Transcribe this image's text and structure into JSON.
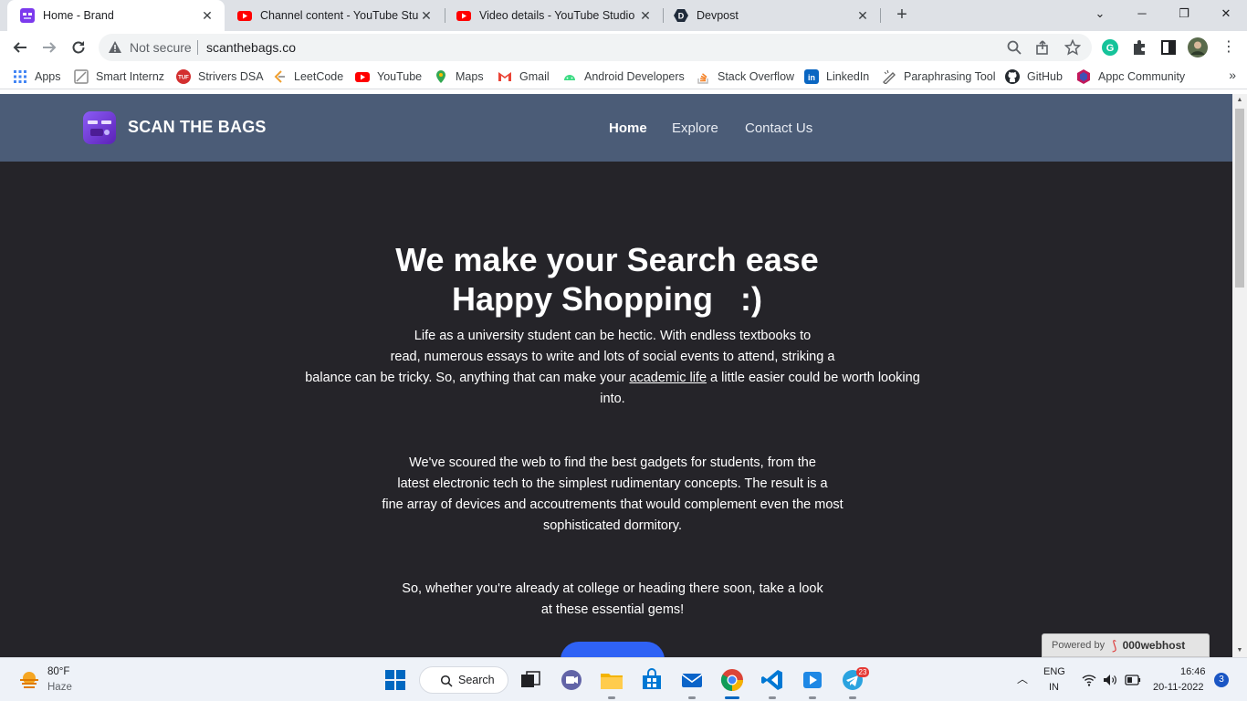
{
  "browser": {
    "tabs": [
      {
        "label": "Home - Brand",
        "favicon": "brand-favicon",
        "active": true
      },
      {
        "label": "Channel content - YouTube Studio",
        "favicon": "youtube-favicon",
        "active": false
      },
      {
        "label": "Video details - YouTube Studio",
        "favicon": "youtube-favicon",
        "active": false
      },
      {
        "label": "Devpost",
        "favicon": "devpost-favicon",
        "active": false
      }
    ],
    "tab_close": "✕",
    "new_tab": "+",
    "window_controls": {
      "minimize": "─",
      "restore": "❐",
      "close": "✕",
      "tab_search": "⌄"
    },
    "security_label": "Not secure",
    "url": "scanthebags.co",
    "bookmarks": [
      {
        "label": "Apps",
        "icon": "apps-grid-icon",
        "color": "#5f6368"
      },
      {
        "label": "Smart Internz",
        "icon": "smart-internz-icon",
        "color": "#888888"
      },
      {
        "label": "Strivers DSA",
        "icon": "strivers-icon",
        "color": "#d32f2f"
      },
      {
        "label": "LeetCode",
        "icon": "leetcode-icon",
        "color": "#f0a030"
      },
      {
        "label": "YouTube",
        "icon": "youtube-icon",
        "color": "#ff0000"
      },
      {
        "label": "Maps",
        "icon": "maps-icon",
        "color": "#34a853"
      },
      {
        "label": "Gmail",
        "icon": "gmail-icon",
        "color": "#ea4335"
      },
      {
        "label": "Android Developers",
        "icon": "android-icon",
        "color": "#3ddc84"
      },
      {
        "label": "Stack Overflow",
        "icon": "stackoverflow-icon",
        "color": "#f48024"
      },
      {
        "label": "LinkedIn",
        "icon": "linkedin-icon",
        "color": "#0a66c2"
      },
      {
        "label": "Paraphrasing Tool",
        "icon": "paraphrase-icon",
        "color": "#777777"
      },
      {
        "label": "GitHub",
        "icon": "github-icon",
        "color": "#24292e"
      },
      {
        "label": "Appc Community",
        "icon": "appc-icon",
        "color": "#c2185b"
      }
    ],
    "bookmarks_more": "»"
  },
  "site": {
    "brand": "SCAN THE BAGS",
    "nav": [
      {
        "label": "Home",
        "active": true
      },
      {
        "label": "Explore",
        "active": false
      },
      {
        "label": "Contact Us",
        "active": false
      }
    ],
    "hero_line1": "We make your Search ease",
    "hero_line2": "Happy Shopping   :)",
    "para1": {
      "line1": "Life as a university student can be hectic. With endless textbooks to",
      "line2": "read, numerous essays to write and lots of social events to attend, striking a",
      "line3_before": "balance can be tricky. So, anything that can make your ",
      "line3_link": "academic life",
      "line3_after": " a little easier could be worth looking",
      "line4": "into."
    },
    "para2": {
      "line1": "We've scoured the web to find the best gadgets for students, from the",
      "line2": "latest electronic tech to the simplest rudimentary concepts. The result is a",
      "line3": "fine array of devices and accoutrements that would complement even the most",
      "line4": "sophisticated dormitory."
    },
    "para3": {
      "line1": "So, whether you're already at college or heading there soon, take a look",
      "line2": "at these essential gems!"
    },
    "powered_by": "Powered by",
    "host_name": "000webhost",
    "colors": {
      "nav_bg": "#4b5c77",
      "page_bg": "#252429",
      "cta": "#2f62f5"
    }
  },
  "taskbar": {
    "temperature": "80°F",
    "weather": "Haze",
    "search_label": "Search",
    "telegram_badge": "23",
    "lang1": "ENG",
    "lang2": "IN",
    "time": "16:46",
    "date": "20-11-2022",
    "notification_count": "3"
  }
}
